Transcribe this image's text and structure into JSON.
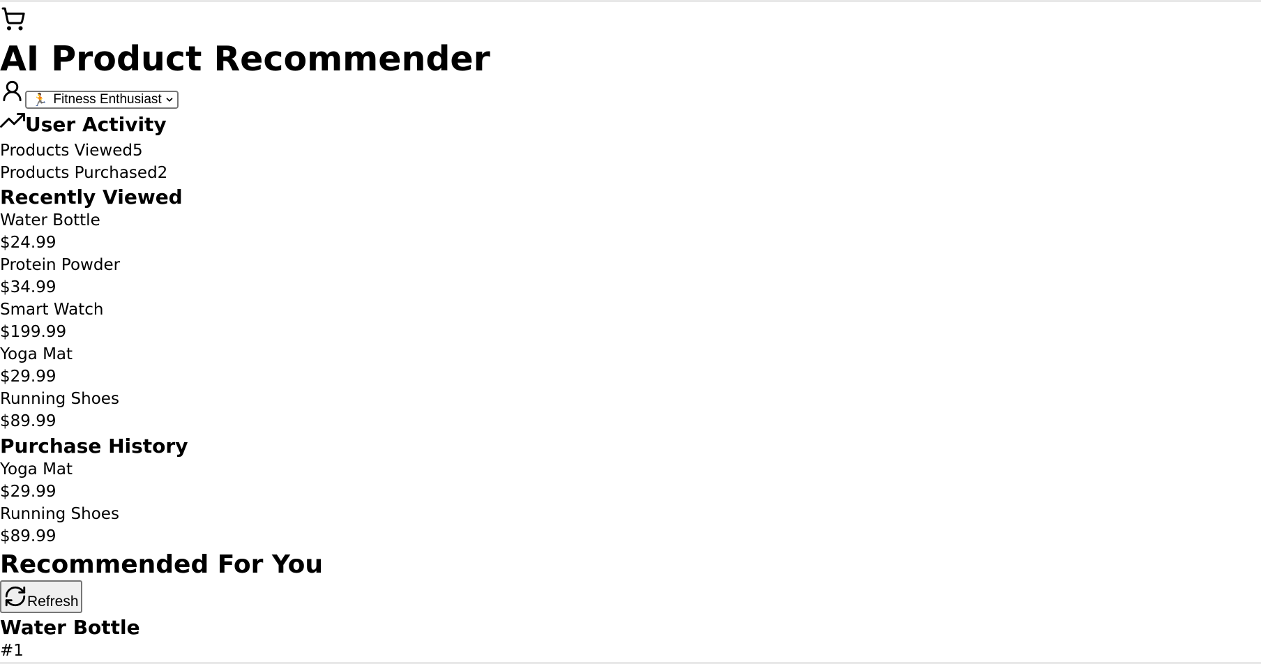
{
  "header": {
    "cart_icon": "shopping-cart-icon",
    "title": "AI Product Recommender"
  },
  "persona": {
    "user_icon": "user-icon",
    "selected_emoji": "🏃",
    "selected_label": "Fitness Enthusiast"
  },
  "activity": {
    "trend_icon": "trending-up-icon",
    "heading": "User Activity",
    "products_viewed_label": "Products Viewed",
    "products_viewed_count": "5",
    "products_purchased_label": "Products Purchased",
    "products_purchased_count": "2"
  },
  "recently_viewed": {
    "heading": "Recently Viewed",
    "items": [
      {
        "name": "Water Bottle",
        "price": "$24.99"
      },
      {
        "name": "Protein Powder",
        "price": "$34.99"
      },
      {
        "name": "Smart Watch",
        "price": "$199.99"
      },
      {
        "name": "Yoga Mat",
        "price": "$29.99"
      },
      {
        "name": "Running Shoes",
        "price": "$89.99"
      }
    ]
  },
  "purchase_history": {
    "heading": "Purchase History",
    "items": [
      {
        "name": "Yoga Mat",
        "price": "$29.99"
      },
      {
        "name": "Running Shoes",
        "price": "$89.99"
      }
    ]
  },
  "recommendations": {
    "heading": "Recommended For You",
    "refresh_icon": "refresh-icon",
    "refresh_label": "Refresh",
    "items": [
      {
        "name": "Water Bottle",
        "rank": "#1"
      }
    ]
  }
}
